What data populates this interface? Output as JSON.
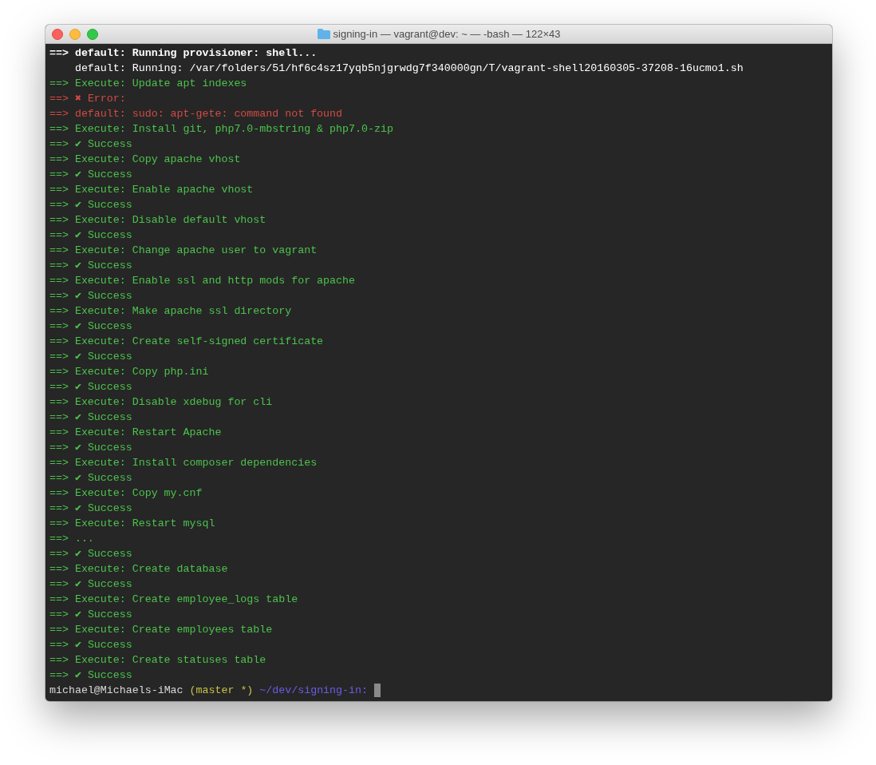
{
  "window": {
    "title": "signing-in — vagrant@dev: ~ — -bash — 122×43"
  },
  "lines": [
    {
      "kind": "info",
      "prefix": "==>",
      "text": "default: Running provisioner: shell..."
    },
    {
      "kind": "info",
      "text": "default: Running: /var/folders/51/hf6c4sz17yqb5njgrwdg7f340000gn/T/vagrant-shell20160305-37208-16ucmo1.sh"
    },
    {
      "kind": "ok",
      "prefix": "==>",
      "text": "Execute: Update apt indexes"
    },
    {
      "kind": "error",
      "prefix": "==>",
      "text": "✖ Error:"
    },
    {
      "kind": "error",
      "prefix": "==>",
      "text": "default: sudo: apt-gete: command not found"
    },
    {
      "kind": "ok",
      "prefix": "==>",
      "text": "Execute: Install git, php7.0-mbstring & php7.0-zip"
    },
    {
      "kind": "ok",
      "prefix": "==>",
      "text": "✔ Success"
    },
    {
      "kind": "ok",
      "prefix": "==>",
      "text": "Execute: Copy apache vhost"
    },
    {
      "kind": "ok",
      "prefix": "==>",
      "text": "✔ Success"
    },
    {
      "kind": "ok",
      "prefix": "==>",
      "text": "Execute: Enable apache vhost"
    },
    {
      "kind": "ok",
      "prefix": "==>",
      "text": "✔ Success"
    },
    {
      "kind": "ok",
      "prefix": "==>",
      "text": "Execute: Disable default vhost"
    },
    {
      "kind": "ok",
      "prefix": "==>",
      "text": "✔ Success"
    },
    {
      "kind": "ok",
      "prefix": "==>",
      "text": "Execute: Change apache user to vagrant"
    },
    {
      "kind": "ok",
      "prefix": "==>",
      "text": "✔ Success"
    },
    {
      "kind": "ok",
      "prefix": "==>",
      "text": "Execute: Enable ssl and http mods for apache"
    },
    {
      "kind": "ok",
      "prefix": "==>",
      "text": "✔ Success"
    },
    {
      "kind": "ok",
      "prefix": "==>",
      "text": "Execute: Make apache ssl directory"
    },
    {
      "kind": "ok",
      "prefix": "==>",
      "text": "✔ Success"
    },
    {
      "kind": "ok",
      "prefix": "==>",
      "text": "Execute: Create self-signed certificate"
    },
    {
      "kind": "ok",
      "prefix": "==>",
      "text": "✔ Success"
    },
    {
      "kind": "ok",
      "prefix": "==>",
      "text": "Execute: Copy php.ini"
    },
    {
      "kind": "ok",
      "prefix": "==>",
      "text": "✔ Success"
    },
    {
      "kind": "ok",
      "prefix": "==>",
      "text": "Execute: Disable xdebug for cli"
    },
    {
      "kind": "ok",
      "prefix": "==>",
      "text": "✔ Success"
    },
    {
      "kind": "ok",
      "prefix": "==>",
      "text": "Execute: Restart Apache"
    },
    {
      "kind": "ok",
      "prefix": "==>",
      "text": "✔ Success"
    },
    {
      "kind": "ok",
      "prefix": "==>",
      "text": "Execute: Install composer dependencies"
    },
    {
      "kind": "ok",
      "prefix": "==>",
      "text": "✔ Success"
    },
    {
      "kind": "ok",
      "prefix": "==>",
      "text": "Execute: Copy my.cnf"
    },
    {
      "kind": "ok",
      "prefix": "==>",
      "text": "✔ Success"
    },
    {
      "kind": "ok",
      "prefix": "==>",
      "text": "Execute: Restart mysql"
    },
    {
      "kind": "ok",
      "prefix": "==>",
      "text": "..."
    },
    {
      "kind": "ok",
      "prefix": "==>",
      "text": "✔ Success"
    },
    {
      "kind": "ok",
      "prefix": "==>",
      "text": "Execute: Create database"
    },
    {
      "kind": "ok",
      "prefix": "==>",
      "text": "✔ Success"
    },
    {
      "kind": "ok",
      "prefix": "==>",
      "text": "Execute: Create employee_logs table"
    },
    {
      "kind": "ok",
      "prefix": "==>",
      "text": "✔ Success"
    },
    {
      "kind": "ok",
      "prefix": "==>",
      "text": "Execute: Create employees table"
    },
    {
      "kind": "ok",
      "prefix": "==>",
      "text": "✔ Success"
    },
    {
      "kind": "ok",
      "prefix": "==>",
      "text": "Execute: Create statuses table"
    },
    {
      "kind": "ok",
      "prefix": "==>",
      "text": "✔ Success"
    }
  ],
  "prompt": {
    "user": "michael@Michaels-iMac",
    "branch": "(master *)",
    "path": "~/dev/signing-in:"
  }
}
